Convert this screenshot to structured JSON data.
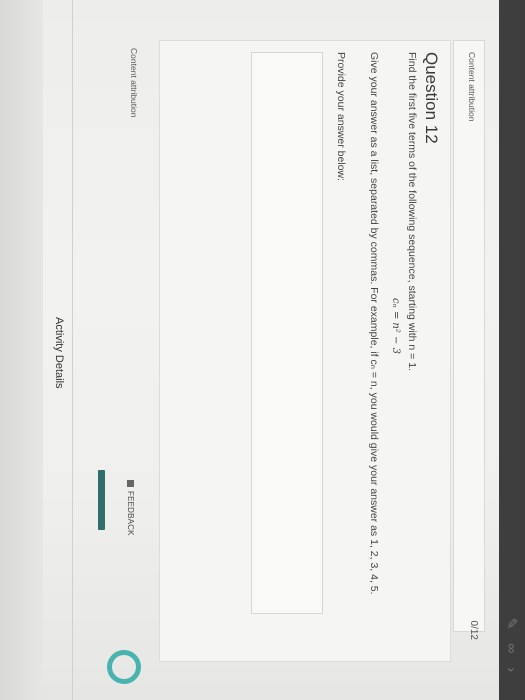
{
  "header": {
    "score": "0/12"
  },
  "attribution": {
    "upper": "Content attribution",
    "lower": "Content attribution"
  },
  "question": {
    "title": "Question 12",
    "prompt": "Find the first five terms of the following sequence, starting with n = 1.",
    "formula": "cₙ = n² − 3",
    "instruction": "Give your answer as a list, separated by commas. For example, if cₙ = n, you would give your answer as 1, 2, 3, 4, 5.",
    "provide": "Provide your answer below:",
    "answer_value": ""
  },
  "feedback": {
    "label": "FEEDBACK",
    "icon": "feedback-icon"
  },
  "footer": {
    "activity_details": "Activity Details"
  },
  "colors": {
    "accent": "#2e6f6a",
    "ring": "#49b3b0"
  }
}
